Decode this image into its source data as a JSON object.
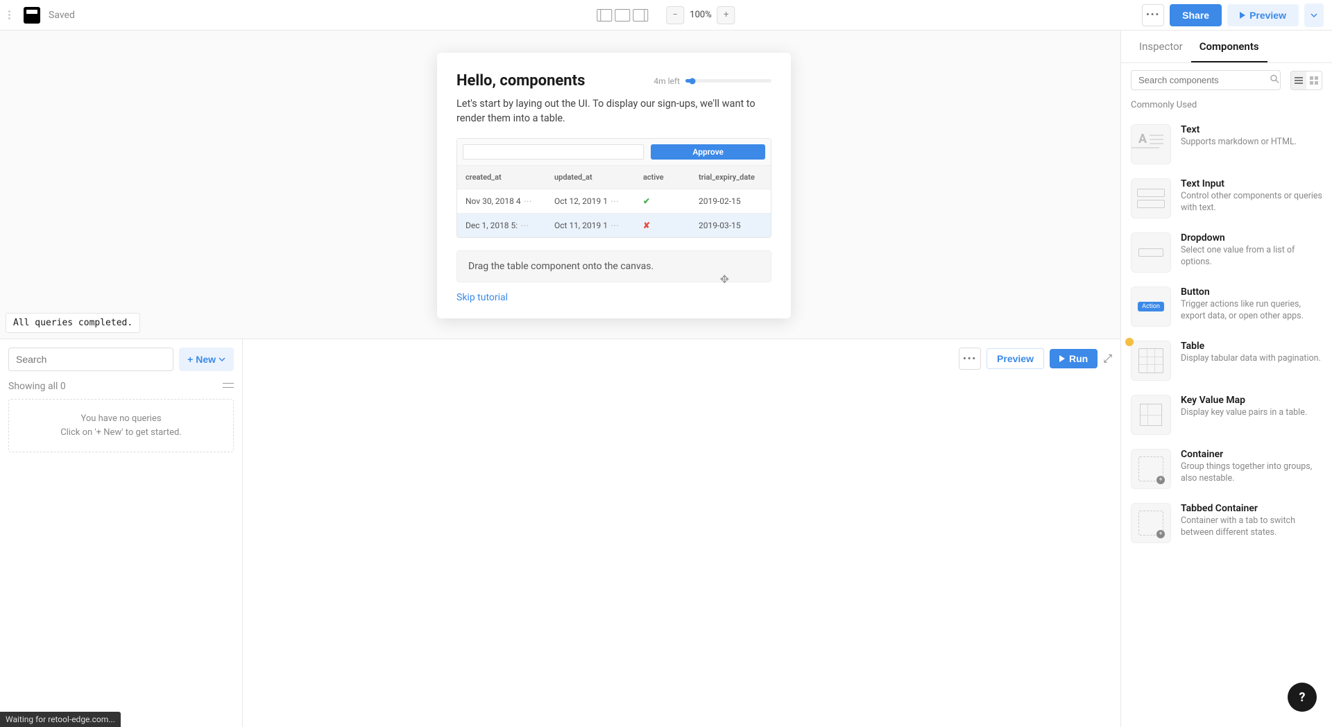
{
  "topbar": {
    "saved_label": "Saved",
    "zoom_minus": "−",
    "zoom_level": "100%",
    "zoom_plus": "+",
    "share_label": "Share",
    "preview_label": "Preview"
  },
  "status_toast": "All queries completed.",
  "queries": {
    "search_placeholder": "Search",
    "new_label": "+ New",
    "showing": "Showing all 0",
    "empty_line1": "You have no queries",
    "empty_line2": "Click on '+ New' to get started."
  },
  "bottom_toolbar": {
    "preview": "Preview",
    "run": "Run"
  },
  "right_panel": {
    "tabs": {
      "inspector": "Inspector",
      "components": "Components"
    },
    "search_placeholder": "Search components",
    "commonly_used": "Commonly Used",
    "items": [
      {
        "title": "Text",
        "desc": "Supports markdown or HTML."
      },
      {
        "title": "Text Input",
        "desc": "Control other components or queries with text."
      },
      {
        "title": "Dropdown",
        "desc": "Select one value from a list of options."
      },
      {
        "title": "Button",
        "desc": "Trigger actions like run queries, export data, or open other apps."
      },
      {
        "title": "Table",
        "desc": "Display tabular data with pagination."
      },
      {
        "title": "Key Value Map",
        "desc": "Display key value pairs in a table."
      },
      {
        "title": "Container",
        "desc": "Group things together into groups, also nestable."
      },
      {
        "title": "Tabbed Container",
        "desc": "Container with a tab to switch between different states."
      }
    ]
  },
  "tutorial": {
    "title": "Hello, components",
    "time": "4m left",
    "body": "Let's start by laying out the UI. To display our sign-ups, we'll want to render them into a table.",
    "approve": "Approve",
    "headers": [
      "created_at",
      "updated_at",
      "active",
      "trial_expiry_date"
    ],
    "rows": [
      {
        "c1": "Nov 30, 2018 4",
        "c2": "Oct 12, 2019 1",
        "c3": "✔",
        "c3cls": "green",
        "c4": "2019-02-15"
      },
      {
        "c1": "Dec 1, 2018 5:",
        "c2": "Oct 11, 2019 1",
        "c3": "✘",
        "c3cls": "red",
        "c4": "2019-03-15"
      }
    ],
    "instruction": "Drag the table component onto the canvas.",
    "skip": "Skip tutorial"
  },
  "footer_status": "Waiting for retool-edge.com...",
  "help": "?"
}
